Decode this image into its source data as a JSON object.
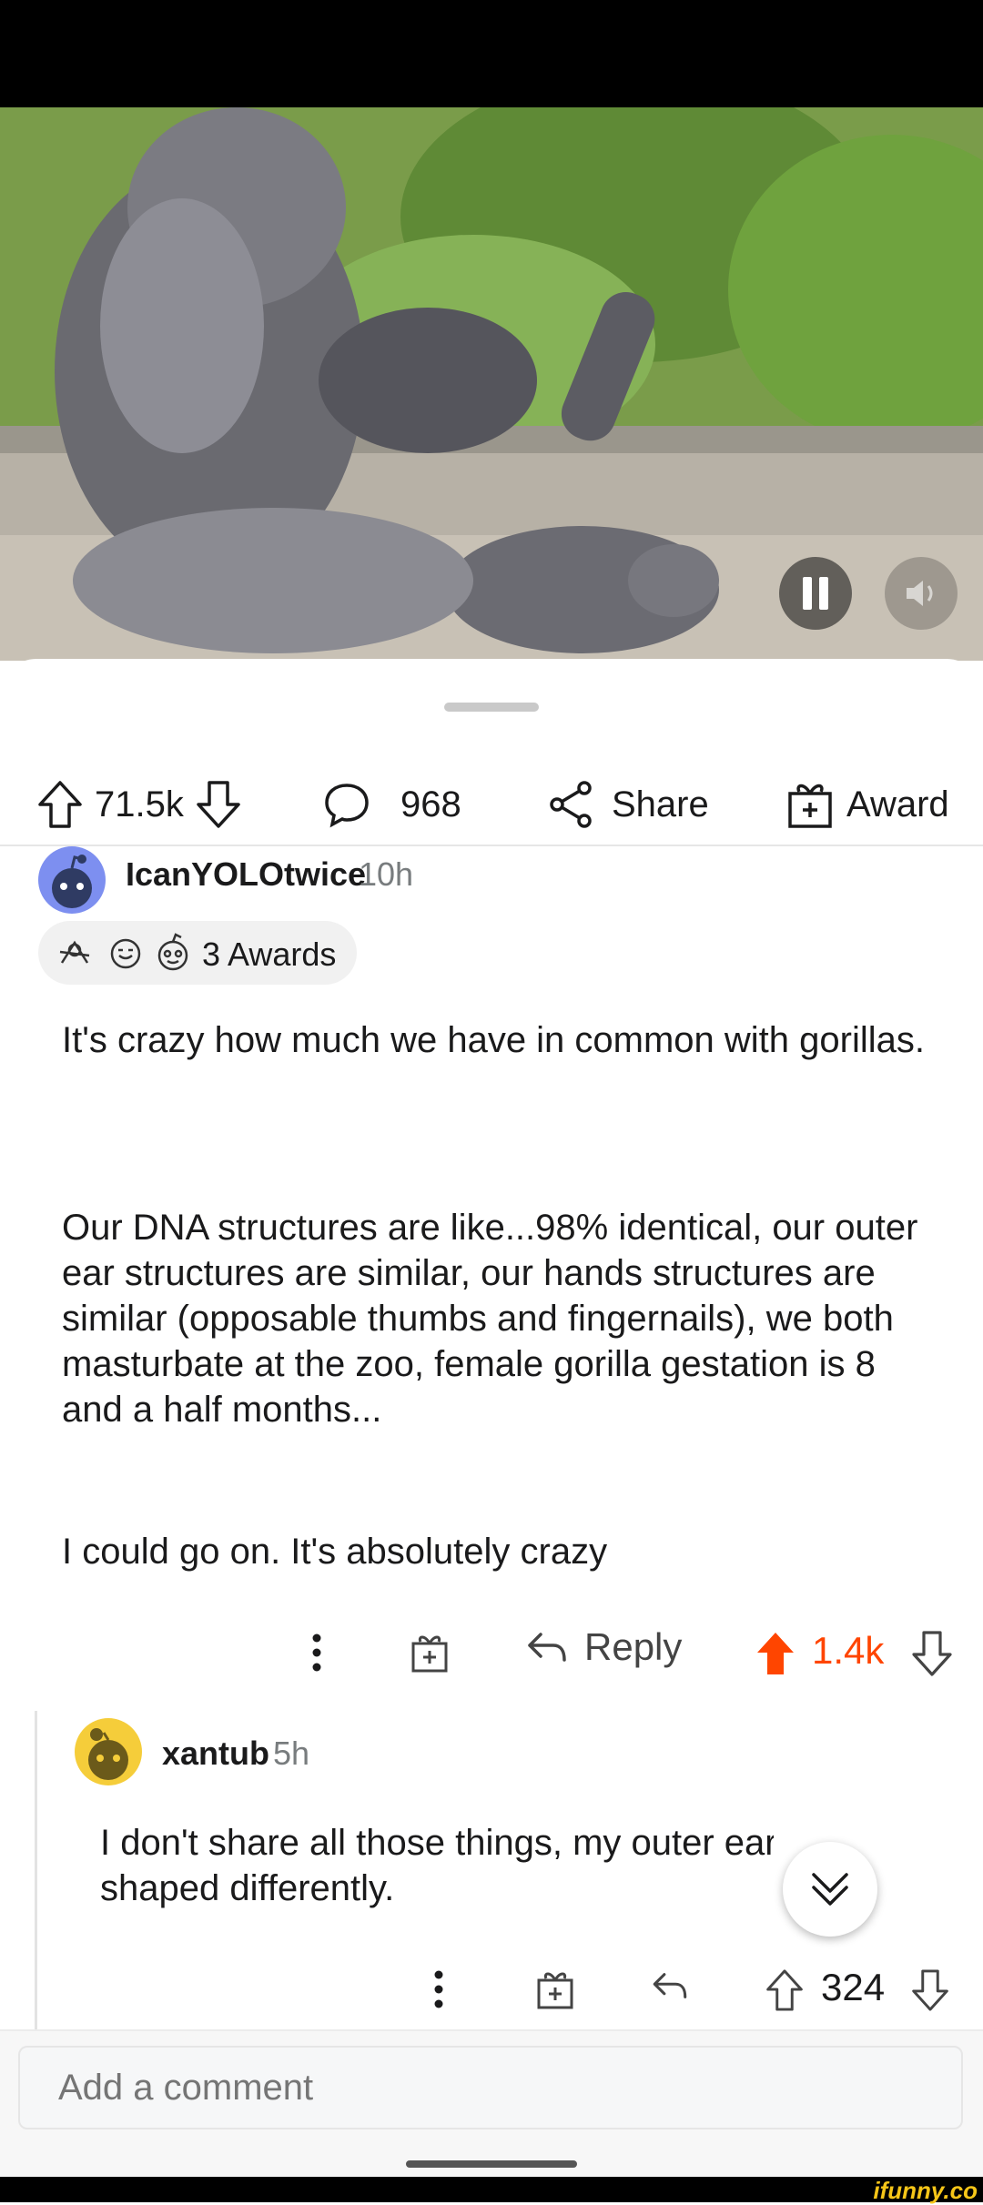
{
  "post": {
    "actions": {
      "upvotes": "71.5k",
      "comments": "968",
      "share_label": "Share",
      "award_label": "Award"
    }
  },
  "comments": [
    {
      "author": "IcanYOLOtwice",
      "age": "10h",
      "awards_label": "3 Awards",
      "paragraphs": [
        "It's crazy how much we have in common with gorillas.",
        "Our DNA structures are like...98% identical, our outer ear structures are similar, our hands structures are similar (opposable thumbs and fingernails), we both masturbate at the zoo, female gorilla gestation is 8 and a half months...",
        "I could go on. It's absolutely crazy"
      ],
      "reply_label": "Reply",
      "score": "1.4k",
      "upvoted": true
    },
    {
      "author": "xantub",
      "age": "5h",
      "text_line1": "I don't share all those things, my outer ear",
      "text_line2": "shaped differently.",
      "score": "324"
    }
  ],
  "composer": {
    "placeholder": "Add a comment"
  },
  "watermark": "ifunny.co",
  "colors": {
    "upvote_accent": "#ff4500",
    "avatar_1": "#7d8ff0",
    "avatar_2": "#f5cd3a"
  },
  "icons": [
    "upvote-icon",
    "downvote-icon",
    "comment-icon",
    "share-icon",
    "gift-icon",
    "more-icon",
    "reply-icon",
    "pause-icon",
    "mute-icon",
    "chevron-double-down-icon",
    "snoo-avatar-icon"
  ]
}
